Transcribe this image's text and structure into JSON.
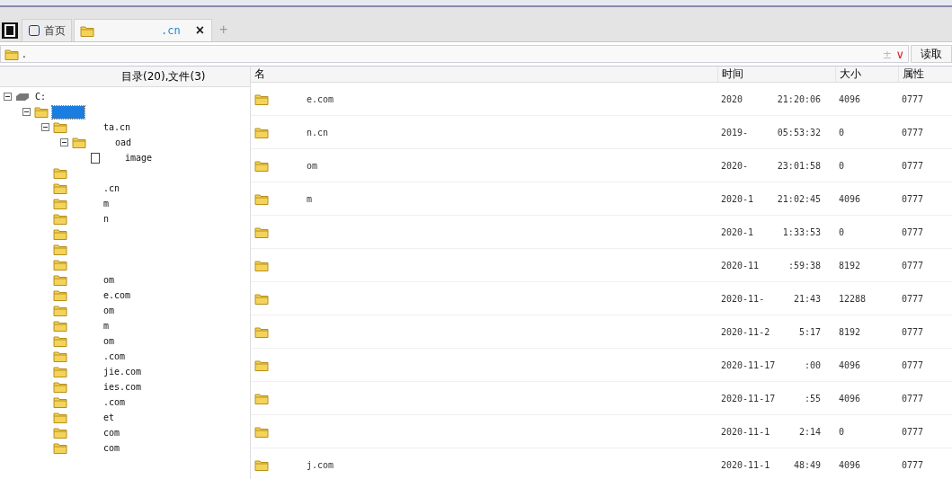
{
  "tabs": [
    {
      "label": "首页",
      "kind": "home",
      "selected": false
    },
    {
      "label": ".cn",
      "kind": "folder",
      "selected": true,
      "close": "×"
    }
  ],
  "new_tab": "+",
  "address": {
    "value": ".",
    "plus_minus": "±",
    "dropdown": "∨",
    "button": "读取"
  },
  "left_header": "目录(20),文件(3)",
  "tree": [
    {
      "label": "C:",
      "kind": "drive",
      "expanded": true,
      "children": [
        {
          "kind": "folder",
          "selected": true,
          "expanded": true,
          "children": [
            {
              "label": "ta.cn",
              "kind": "folder",
              "expanded": true,
              "children": [
                {
                  "label": "oad",
                  "kind": "folder",
                  "expanded": true,
                  "children": [
                    {
                      "label": "image",
                      "kind": "file"
                    }
                  ]
                }
              ]
            },
            {
              "kind": "folder"
            },
            {
              "label": ".cn",
              "kind": "folder"
            },
            {
              "label": "m",
              "kind": "folder"
            },
            {
              "label": "n",
              "kind": "folder"
            },
            {
              "kind": "folder"
            },
            {
              "kind": "folder"
            },
            {
              "kind": "folder"
            },
            {
              "label": "om",
              "kind": "folder"
            },
            {
              "label": "e.com",
              "kind": "folder"
            },
            {
              "label": "om",
              "kind": "folder"
            },
            {
              "label": "m",
              "kind": "folder"
            },
            {
              "label": "om",
              "kind": "folder"
            },
            {
              "label": ".com",
              "kind": "folder"
            },
            {
              "label": "jie.com",
              "kind": "folder"
            },
            {
              "label": "ies.com",
              "kind": "folder"
            },
            {
              "label": ".com",
              "kind": "folder"
            },
            {
              "label": "et",
              "kind": "folder"
            },
            {
              "label": "com",
              "kind": "folder"
            },
            {
              "label": "com",
              "kind": "folder"
            }
          ]
        }
      ]
    }
  ],
  "columns": [
    "名",
    "时间",
    "大小",
    "属性"
  ],
  "rows": [
    {
      "name": "e.com",
      "date": "2020",
      "time": "21:20:06",
      "size": "4096",
      "attr": "0777"
    },
    {
      "name": "n.cn",
      "date": "2019-",
      "time": "05:53:32",
      "size": "0",
      "attr": "0777"
    },
    {
      "name": "om",
      "date": "2020-",
      "time": "23:01:58",
      "size": "0",
      "attr": "0777"
    },
    {
      "name": "m",
      "date": "2020-1",
      "time": "21:02:45",
      "size": "4096",
      "attr": "0777"
    },
    {
      "date": "2020-1",
      "time": "1:33:53",
      "size": "0",
      "attr": "0777"
    },
    {
      "date": "2020-11",
      "time": ":59:38",
      "size": "8192",
      "attr": "0777"
    },
    {
      "date": "2020-11-",
      "time": "21:43",
      "size": "12288",
      "attr": "0777"
    },
    {
      "date": "2020-11-2",
      "time": "5:17",
      "size": "8192",
      "attr": "0777"
    },
    {
      "date": "2020-11-17",
      "time": ":00",
      "size": "4096",
      "attr": "0777"
    },
    {
      "date": "2020-11-17",
      "time": ":55",
      "size": "4096",
      "attr": "0777"
    },
    {
      "date": "2020-11-1",
      "time": "2:14",
      "size": "0",
      "attr": "0777"
    },
    {
      "name": "j.com",
      "date": "2020-11-1",
      "time": "48:49",
      "size": "4096",
      "attr": "0777"
    }
  ]
}
